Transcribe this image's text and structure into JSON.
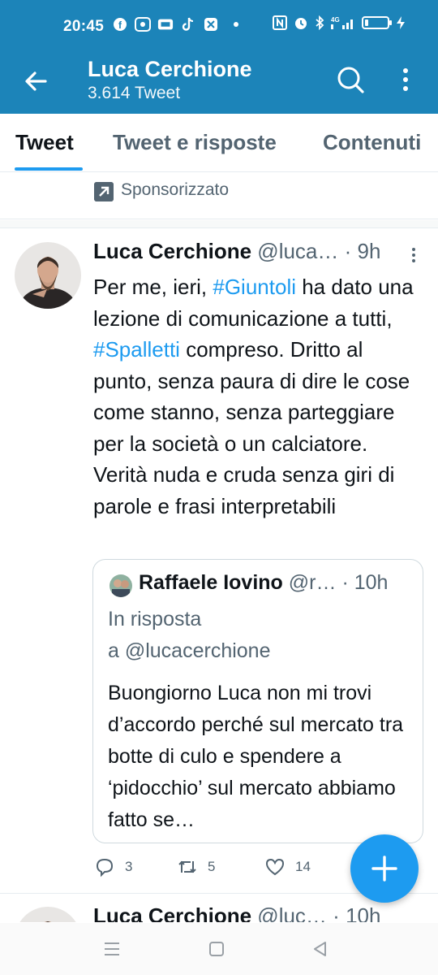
{
  "status_bar": {
    "time": "20:45",
    "left_icons": [
      "facebook-icon",
      "radio-icon",
      "game-icon",
      "tiktok-icon",
      "app-icon"
    ],
    "right_icons": [
      "nfc-icon",
      "alarm-icon",
      "bluetooth-icon",
      "signal-4g-icon",
      "battery-icon",
      "charging-icon"
    ],
    "network": "4G",
    "battery_level_fraction": 0.15
  },
  "app_bar": {
    "title": "Luca Cerchione",
    "subtitle": "3.614 Tweet",
    "color": "#1c84b9"
  },
  "tabs": [
    {
      "label": "Tweet",
      "active": true
    },
    {
      "label": "Tweet e risposte",
      "active": false
    },
    {
      "label": "Contenuti",
      "active": false
    }
  ],
  "promo": {
    "label": "Sponsorizzato"
  },
  "tweet": {
    "name": "Luca Cerchione",
    "handle": "@luca…",
    "separator": "·",
    "time": "9h",
    "body": {
      "t1": "Per me, ieri, ",
      "h1": "#Giuntoli",
      "t2": " ha dato una lezione di comunicazione a tutti, ",
      "h2": "#Spalletti",
      "t3": " compreso. Dritto al punto, senza paura di dire le cose come stanno, senza parteggiare per la società o un calciatore. Verità nuda e cruda senza giri di parole e frasi interpretabili"
    },
    "quote": {
      "name": "Raffaele Iovino",
      "handle": "@r…",
      "separator": "·",
      "time": "10h",
      "reply_line1": "In risposta",
      "reply_line2": "a @lucacerchione",
      "body": "Buongiorno Luca non mi trovi d’accordo perché sul mercato tra botte di culo e spendere a ‘pidocchio’ sul mercato abbiamo fatto se…"
    },
    "actions": {
      "replies": "3",
      "retweets": "5",
      "likes": "14"
    }
  },
  "next_tweet": {
    "name": "Luca Cerchione",
    "handle": "@luc…",
    "separator": "·",
    "time": "10h"
  },
  "colors": {
    "accent": "#1d9bf0",
    "secondary_text": "#536471"
  }
}
